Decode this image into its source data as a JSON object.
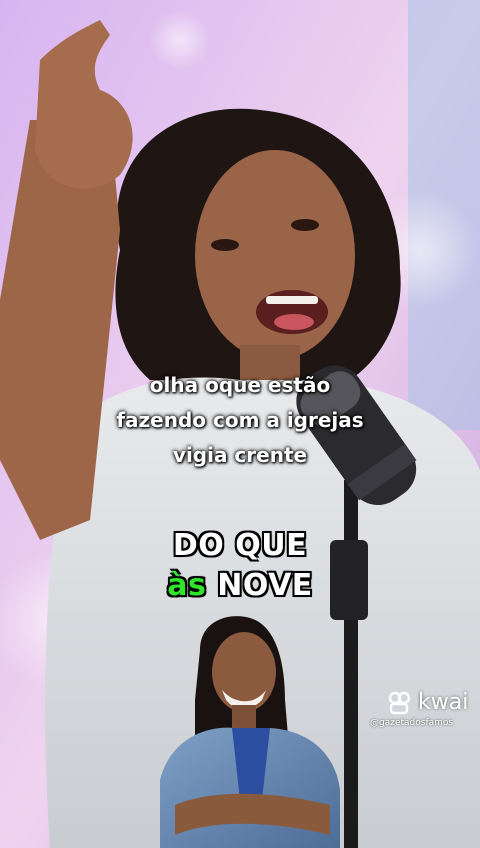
{
  "video": {
    "scene": "singer-girl-with-microphone",
    "caption_lines": [
      "olha oque estão",
      "fazendo com a igrejas",
      "vigia crente"
    ],
    "lyric_line1": "DO QUE",
    "lyric_line2_highlight": "às",
    "lyric_line2_rest": "NOVE"
  },
  "watermark": {
    "brand": "kwai",
    "handle": "@gazetadosfamos",
    "icon": "kwai-logo-icon"
  },
  "colors": {
    "highlight": "#2ee52b",
    "caption_text": "#ffffff",
    "background_lavender": "#d7b6e6"
  }
}
